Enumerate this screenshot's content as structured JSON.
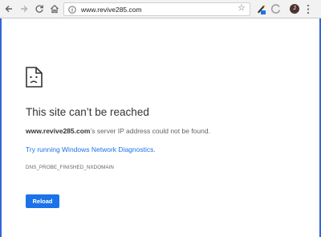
{
  "browser": {
    "url": "www.revive285.com",
    "avatar_letter": "J",
    "star_glyph": "☆",
    "icons": [
      "back-arrow-icon",
      "forward-arrow-icon",
      "reload-icon",
      "home-icon",
      "info-icon",
      "star-icon",
      "pen-extension-icon",
      "circle-extension-icon",
      "avatar",
      "kebab-menu-icon"
    ]
  },
  "error_page": {
    "icon": "sad-page-icon",
    "title": "This site can’t be reached",
    "host": "www.revive285.com",
    "description_rest": "’s server IP address could not be found.",
    "diagnostics_link": "Try running Windows Network Diagnostics.",
    "error_code": "DNS_PROBE_FINISHED_NXDOMAIN",
    "reload_label": "Reload"
  },
  "colors": {
    "accent": "#1a73e8",
    "frame": "#3367d6",
    "toolbar": "#f2f2f2",
    "title": "#333333",
    "body_text": "#646464"
  }
}
